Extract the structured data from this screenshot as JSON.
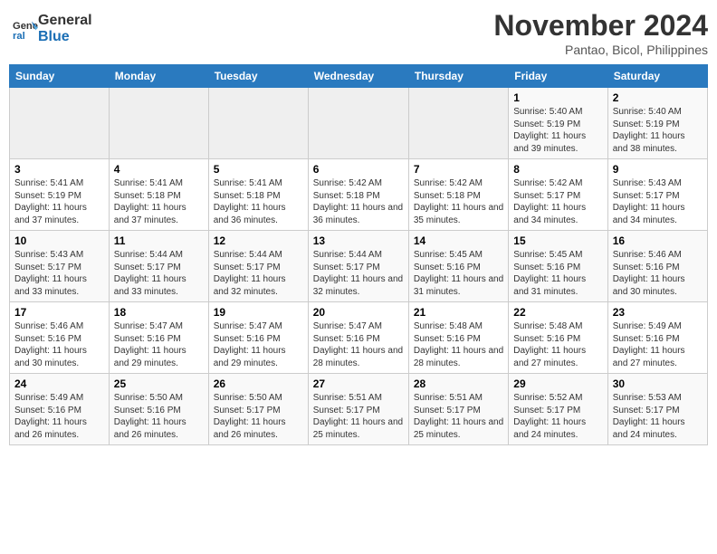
{
  "header": {
    "logo_line1": "General",
    "logo_line2": "Blue",
    "month_title": "November 2024",
    "subtitle": "Pantao, Bicol, Philippines"
  },
  "days_of_week": [
    "Sunday",
    "Monday",
    "Tuesday",
    "Wednesday",
    "Thursday",
    "Friday",
    "Saturday"
  ],
  "weeks": [
    {
      "days": [
        {
          "num": "",
          "info": ""
        },
        {
          "num": "",
          "info": ""
        },
        {
          "num": "",
          "info": ""
        },
        {
          "num": "",
          "info": ""
        },
        {
          "num": "",
          "info": ""
        },
        {
          "num": "1",
          "info": "Sunrise: 5:40 AM\nSunset: 5:19 PM\nDaylight: 11 hours and 39 minutes."
        },
        {
          "num": "2",
          "info": "Sunrise: 5:40 AM\nSunset: 5:19 PM\nDaylight: 11 hours and 38 minutes."
        }
      ]
    },
    {
      "days": [
        {
          "num": "3",
          "info": "Sunrise: 5:41 AM\nSunset: 5:19 PM\nDaylight: 11 hours and 37 minutes."
        },
        {
          "num": "4",
          "info": "Sunrise: 5:41 AM\nSunset: 5:18 PM\nDaylight: 11 hours and 37 minutes."
        },
        {
          "num": "5",
          "info": "Sunrise: 5:41 AM\nSunset: 5:18 PM\nDaylight: 11 hours and 36 minutes."
        },
        {
          "num": "6",
          "info": "Sunrise: 5:42 AM\nSunset: 5:18 PM\nDaylight: 11 hours and 36 minutes."
        },
        {
          "num": "7",
          "info": "Sunrise: 5:42 AM\nSunset: 5:18 PM\nDaylight: 11 hours and 35 minutes."
        },
        {
          "num": "8",
          "info": "Sunrise: 5:42 AM\nSunset: 5:17 PM\nDaylight: 11 hours and 34 minutes."
        },
        {
          "num": "9",
          "info": "Sunrise: 5:43 AM\nSunset: 5:17 PM\nDaylight: 11 hours and 34 minutes."
        }
      ]
    },
    {
      "days": [
        {
          "num": "10",
          "info": "Sunrise: 5:43 AM\nSunset: 5:17 PM\nDaylight: 11 hours and 33 minutes."
        },
        {
          "num": "11",
          "info": "Sunrise: 5:44 AM\nSunset: 5:17 PM\nDaylight: 11 hours and 33 minutes."
        },
        {
          "num": "12",
          "info": "Sunrise: 5:44 AM\nSunset: 5:17 PM\nDaylight: 11 hours and 32 minutes."
        },
        {
          "num": "13",
          "info": "Sunrise: 5:44 AM\nSunset: 5:17 PM\nDaylight: 11 hours and 32 minutes."
        },
        {
          "num": "14",
          "info": "Sunrise: 5:45 AM\nSunset: 5:16 PM\nDaylight: 11 hours and 31 minutes."
        },
        {
          "num": "15",
          "info": "Sunrise: 5:45 AM\nSunset: 5:16 PM\nDaylight: 11 hours and 31 minutes."
        },
        {
          "num": "16",
          "info": "Sunrise: 5:46 AM\nSunset: 5:16 PM\nDaylight: 11 hours and 30 minutes."
        }
      ]
    },
    {
      "days": [
        {
          "num": "17",
          "info": "Sunrise: 5:46 AM\nSunset: 5:16 PM\nDaylight: 11 hours and 30 minutes."
        },
        {
          "num": "18",
          "info": "Sunrise: 5:47 AM\nSunset: 5:16 PM\nDaylight: 11 hours and 29 minutes."
        },
        {
          "num": "19",
          "info": "Sunrise: 5:47 AM\nSunset: 5:16 PM\nDaylight: 11 hours and 29 minutes."
        },
        {
          "num": "20",
          "info": "Sunrise: 5:47 AM\nSunset: 5:16 PM\nDaylight: 11 hours and 28 minutes."
        },
        {
          "num": "21",
          "info": "Sunrise: 5:48 AM\nSunset: 5:16 PM\nDaylight: 11 hours and 28 minutes."
        },
        {
          "num": "22",
          "info": "Sunrise: 5:48 AM\nSunset: 5:16 PM\nDaylight: 11 hours and 27 minutes."
        },
        {
          "num": "23",
          "info": "Sunrise: 5:49 AM\nSunset: 5:16 PM\nDaylight: 11 hours and 27 minutes."
        }
      ]
    },
    {
      "days": [
        {
          "num": "24",
          "info": "Sunrise: 5:49 AM\nSunset: 5:16 PM\nDaylight: 11 hours and 26 minutes."
        },
        {
          "num": "25",
          "info": "Sunrise: 5:50 AM\nSunset: 5:16 PM\nDaylight: 11 hours and 26 minutes."
        },
        {
          "num": "26",
          "info": "Sunrise: 5:50 AM\nSunset: 5:17 PM\nDaylight: 11 hours and 26 minutes."
        },
        {
          "num": "27",
          "info": "Sunrise: 5:51 AM\nSunset: 5:17 PM\nDaylight: 11 hours and 25 minutes."
        },
        {
          "num": "28",
          "info": "Sunrise: 5:51 AM\nSunset: 5:17 PM\nDaylight: 11 hours and 25 minutes."
        },
        {
          "num": "29",
          "info": "Sunrise: 5:52 AM\nSunset: 5:17 PM\nDaylight: 11 hours and 24 minutes."
        },
        {
          "num": "30",
          "info": "Sunrise: 5:53 AM\nSunset: 5:17 PM\nDaylight: 11 hours and 24 minutes."
        }
      ]
    }
  ]
}
